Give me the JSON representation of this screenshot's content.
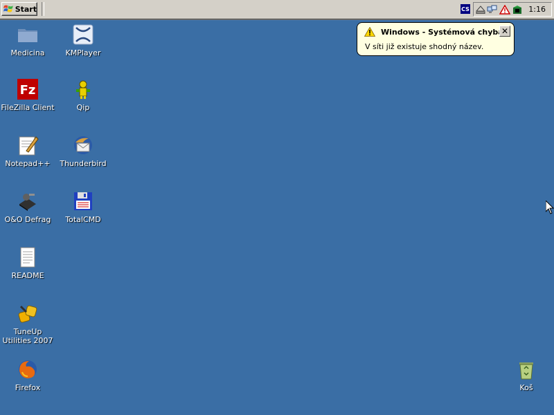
{
  "taskbar": {
    "start_label": "Start",
    "language": "CS",
    "clock": "1:16"
  },
  "balloon": {
    "title": "Windows - Systémová chyba",
    "message": "V síti již existuje shodný název.",
    "close_label": "✕"
  },
  "desktop": {
    "icons": [
      {
        "label": "Medicina",
        "icon": "folder-icon"
      },
      {
        "label": "KMPlayer",
        "icon": "kmplayer-icon"
      },
      {
        "label": "FileZilla Client",
        "icon": "filezilla-icon"
      },
      {
        "label": "Qip",
        "icon": "qip-icon"
      },
      {
        "label": "Notepad++",
        "icon": "notepad-icon"
      },
      {
        "label": "Thunderbird",
        "icon": "thunderbird-icon"
      },
      {
        "label": "O&O Defrag",
        "icon": "defrag-icon"
      },
      {
        "label": "TotalCMD",
        "icon": "floppy-icon"
      },
      {
        "label": "README",
        "icon": "document-icon"
      },
      {
        "label": "TuneUp Utilities 2007",
        "icon": "tuneup-icon"
      },
      {
        "label": "Firefox",
        "icon": "firefox-icon"
      },
      {
        "label": "Koš",
        "icon": "recycle-bin-icon"
      }
    ]
  },
  "colors": {
    "desktop": "#3a6ea5",
    "taskbar": "#d4d0c8",
    "balloon": "#ffffe1"
  }
}
